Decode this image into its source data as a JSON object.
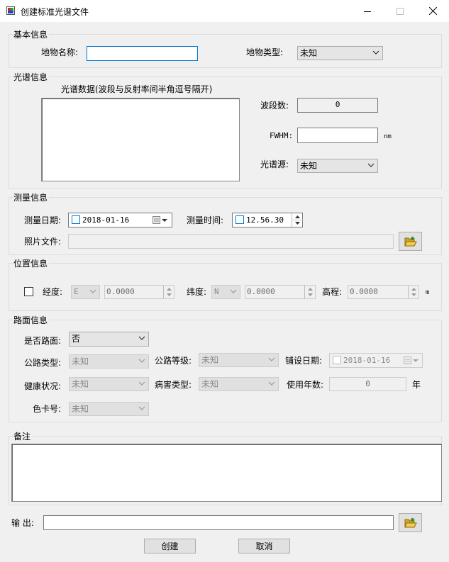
{
  "window": {
    "title": "创建标准光谱文件"
  },
  "basic": {
    "title": "基本信息",
    "name_label": "地物名称:",
    "name_value": "",
    "type_label": "地物类型:",
    "type_value": "未知"
  },
  "spectrum": {
    "title": "光谱信息",
    "data_label": "光谱数据(波段与反射率间半角逗号隔开)",
    "data_value": "",
    "bands_label": "波段数:",
    "bands_value": "0",
    "fwhm_label": "FWHM:",
    "fwhm_value": "",
    "fwhm_unit": "nm",
    "source_label": "光谱源:",
    "source_value": "未知"
  },
  "measure": {
    "title": "测量信息",
    "date_label": "测量日期:",
    "date_value": "2018-01-16",
    "time_label": "测量时间:",
    "time_value": "12.56.30",
    "photo_label": "照片文件:",
    "photo_value": ""
  },
  "position": {
    "title": "位置信息",
    "lon_label": "经度:",
    "lon_dir": "E",
    "lon_value": "0.0000",
    "lat_label": "纬度:",
    "lat_dir": "N",
    "lat_value": "0.0000",
    "elev_label": "高程:",
    "elev_value": "0.0000",
    "elev_unit": "m"
  },
  "road": {
    "title": "路面信息",
    "is_road_label": "是否路面:",
    "is_road_value": "否",
    "road_type_label": "公路类型:",
    "road_type_value": "未知",
    "road_grade_label": "公路等级:",
    "road_grade_value": "未知",
    "pave_date_label": "铺设日期:",
    "pave_date_value": "2018-01-16",
    "health_label": "健康状况:",
    "health_value": "未知",
    "damage_label": "病害类型:",
    "damage_value": "未知",
    "years_label": "使用年数:",
    "years_value": "0",
    "years_unit": "年",
    "color_label": "色卡号:",
    "color_value": "未知"
  },
  "notes": {
    "title": "备注",
    "value": ""
  },
  "output": {
    "label": "输 出:",
    "value": "",
    "create_label": "创建",
    "cancel_label": "取消"
  },
  "icons": {
    "app": "app-icon",
    "minimize": "minimize-icon",
    "maximize": "maximize-icon",
    "close": "close-icon",
    "folder": "folder-open-icon",
    "dropdown": "chevron-down-icon",
    "calendar": "calendar-icon"
  },
  "colors": {
    "focus_border": "#0078d7",
    "window_bg": "#f0f0f0"
  }
}
